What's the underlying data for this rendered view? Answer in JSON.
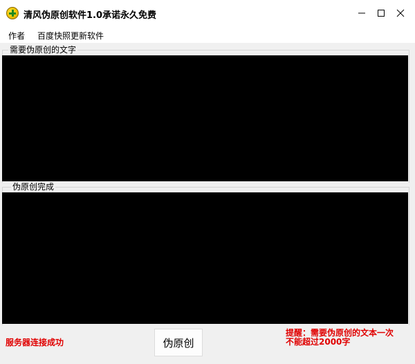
{
  "window": {
    "title": "清风伪原创软件1.0承诺永久免费",
    "icon": "app-plus-icon"
  },
  "menu": {
    "items": [
      "作者",
      "百度快照更新软件"
    ]
  },
  "input_group": {
    "label": "需要伪原创的文字",
    "value": ""
  },
  "output_group": {
    "label": "伪原创完成",
    "value": ""
  },
  "status": {
    "text": "服务器连接成功",
    "color": "#e00000"
  },
  "action": {
    "button_label": "伪原创"
  },
  "notice": {
    "line1": "提醒：需要伪原创的文本一次",
    "line2": "不能超过2000字",
    "color": "#e00000"
  }
}
